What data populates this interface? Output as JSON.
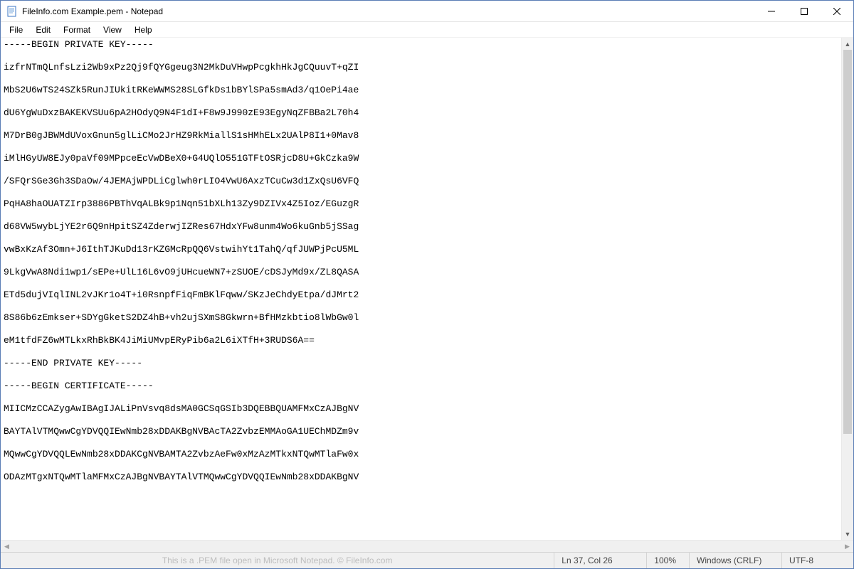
{
  "window": {
    "title": "FileInfo.com Example.pem - Notepad"
  },
  "menubar": {
    "items": [
      "File",
      "Edit",
      "Format",
      "View",
      "Help"
    ]
  },
  "editor": {
    "content": "-----BEGIN PRIVATE KEY-----\n\nizfrNTmQLnfsLzi2Wb9xPz2Qj9fQYGgeug3N2MkDuVHwpPcgkhHkJgCQuuvT+qZI\n\nMbS2U6wTS24SZk5RunJIUkitRKeWWMS28SLGfkDs1bBYlSPa5smAd3/q1OePi4ae\n\ndU6YgWuDxzBAKEKVSUu6pA2HOdyQ9N4F1dI+F8w9J990zE93EgyNqZFBBa2L70h4\n\nM7DrB0gJBWMdUVoxGnun5glLiCMo2JrHZ9RkMiallS1sHMhELx2UAlP8I1+0Mav8\n\niMlHGyUW8EJy0paVf09MPpceEcVwDBeX0+G4UQlO551GTFtOSRjcD8U+GkCzka9W\n\n/SFQrSGe3Gh3SDaOw/4JEMAjWPDLiCglwh0rLIO4VwU6AxzTCuCw3d1ZxQsU6VFQ\n\nPqHA8haOUATZIrp3886PBThVqALBk9p1Nqn51bXLh13Zy9DZIVx4Z5Ioz/EGuzgR\n\nd68VW5wybLjYE2r6Q9nHpitSZ4ZderwjIZRes67HdxYFw8unm4Wo6kuGnb5jSSag\n\nvwBxKzAf3Omn+J6IthTJKuDd13rKZGMcRpQQ6VstwihYt1TahQ/qfJUWPjPcU5ML\n\n9LkgVwA8Ndi1wp1/sEPe+UlL16L6vO9jUHcueWN7+zSUOE/cDSJyMd9x/ZL8QASA\n\nETd5dujVIqlINL2vJKr1o4T+i0RsnpfFiqFmBKlFqww/SKzJeChdyEtpa/dJMrt2\n\n8S86b6zEmkser+SDYgGketS2DZ4hB+vh2ujSXmS8Gkwrn+BfHMzkbtio8lWbGw0l\n\neM1tfdFZ6wMTLkxRhBkBK4JiMiUMvpERyPib6a2L6iXTfH+3RUDS6A==\n\n-----END PRIVATE KEY-----\n\n-----BEGIN CERTIFICATE-----\n\nMIICMzCCAZygAwIBAgIJALiPnVsvq8dsMA0GCSqGSIb3DQEBBQUAMFMxCzAJBgNV\n\nBAYTAlVTMQwwCgYDVQQIEwNmb28xDDAKBgNVBAcTA2ZvbzEMMAoGA1UEChMDZm9v\n\nMQwwCgYDVQQLEwNmb28xDDAKCgNVBAMTA2ZvbzAeFw0xMzAzMTkxNTQwMTlaFw0x\n\nODAzMTgxNTQwMTlaMFMxCzAJBgNVBAYTAlVTMQwwCgYDVQQIEwNmb28xDDAKBgNV"
  },
  "statusbar": {
    "watermark": "This is a .PEM file open in Microsoft Notepad. © FileInfo.com",
    "position": "Ln 37, Col 26",
    "zoom": "100%",
    "line_ending": "Windows (CRLF)",
    "encoding": "UTF-8"
  }
}
